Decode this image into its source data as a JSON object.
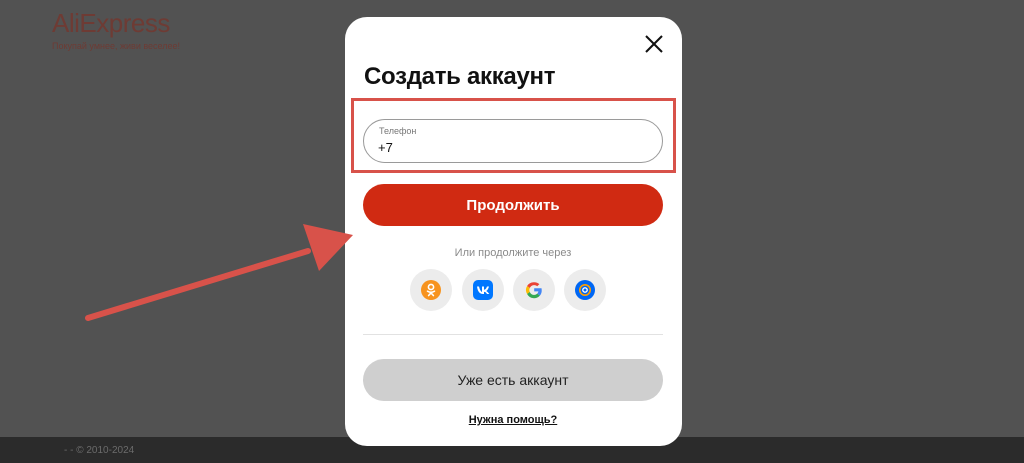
{
  "background": {
    "logo": "AliExpress",
    "tagline": "Покупай умнее, живи веселее!",
    "footer": "- -  © 2010-2024"
  },
  "modal": {
    "title": "Создать аккаунт",
    "phone_label": "Телефон",
    "phone_value": "+7",
    "continue_label": "Продолжить",
    "or_text": "Или продолжите через",
    "social": [
      "odnoklassniki-icon",
      "vk-icon",
      "google-icon",
      "mail-icon"
    ],
    "login_label": "Уже есть аккаунт",
    "help_label": "Нужна помощь?"
  },
  "colors": {
    "accent": "#d02a12",
    "annotation": "#d8524a",
    "overlay": "#525252"
  }
}
